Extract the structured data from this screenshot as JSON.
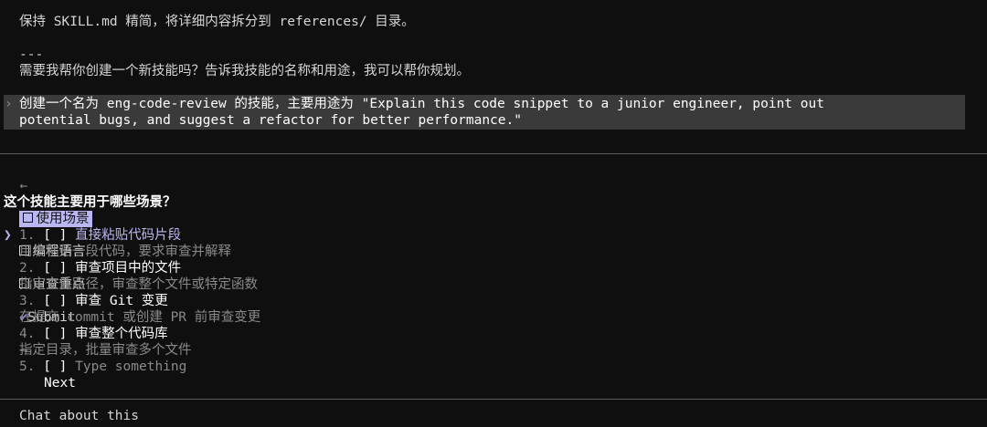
{
  "history": {
    "line1": "保持 SKILL.md 精简，将详细内容拆分到 references/ 目录。",
    "separator": "---",
    "line2": "需要我帮你创建一个新技能吗？告诉我技能的名称和用途，我可以帮你规划。"
  },
  "user_message": {
    "prompt_marker": "›",
    "line1": "创建一个名为 eng-code-review 的技能，主要用途为 \"Explain this code snippet to a junior engineer, point out",
    "line2": "potential bugs, and suggest a refactor for better performance.\""
  },
  "tabs": {
    "left_arrow": "←",
    "right_arrow": "→",
    "items": [
      {
        "label": "使用场景",
        "active": true
      },
      {
        "label": "编程语言",
        "active": false
      },
      {
        "label": "审查重点",
        "active": false
      }
    ],
    "submit_label": "Submit"
  },
  "question": "这个技能主要用于哪些场景？",
  "options": [
    {
      "num": "1.",
      "checkbox": "[ ]",
      "title": "直接粘贴代码片段",
      "desc": "用户粘贴一段代码，要求审查并解释",
      "selected": true
    },
    {
      "num": "2.",
      "checkbox": "[ ]",
      "title": "审查项目中的文件",
      "desc": "指定文件路径，审查整个文件或特定函数"
    },
    {
      "num": "3.",
      "checkbox": "[ ]",
      "title": "审查 Git 变更",
      "desc": "在提交 commit 或创建 PR 前审查变更"
    },
    {
      "num": "4.",
      "checkbox": "[ ]",
      "title": "审查整个代码库",
      "desc": "指定目录，批量审查多个文件"
    },
    {
      "num": "5.",
      "checkbox": "[ ]",
      "title": "Type something",
      "desc": ""
    }
  ],
  "cursor_marker": "❯",
  "next_label": "Next",
  "chat_placeholder": "Chat about this"
}
